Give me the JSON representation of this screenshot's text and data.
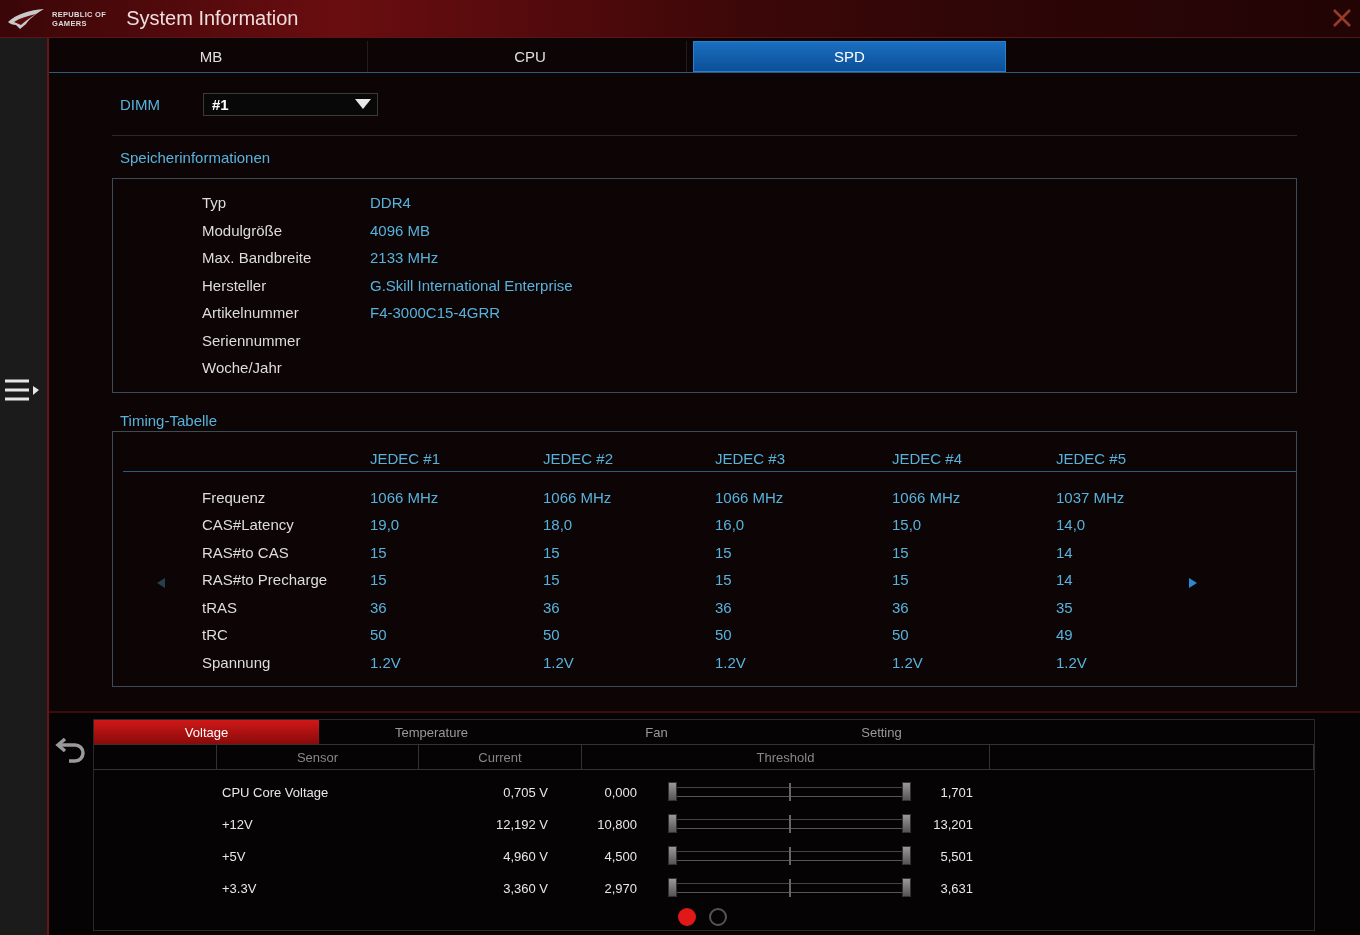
{
  "title_bar": {
    "logo_text": [
      "REPUBLIC OF",
      "GAMERS"
    ],
    "title": "System Information"
  },
  "tabs": [
    {
      "label": "MB",
      "selected": false
    },
    {
      "label": "CPU",
      "selected": false
    },
    {
      "label": "SPD",
      "selected": true
    }
  ],
  "dimm": {
    "label": "DIMM",
    "value": "#1"
  },
  "memory_info": {
    "title": "Speicherinformationen",
    "rows": [
      {
        "label": "Typ",
        "value": "DDR4"
      },
      {
        "label": "Modulgröße",
        "value": "4096 MB"
      },
      {
        "label": "Max. Bandbreite",
        "value": "2133 MHz"
      },
      {
        "label": "Hersteller",
        "value": "G.Skill International Enterprise"
      },
      {
        "label": "Artikelnummer",
        "value": "F4-3000C15-4GRR"
      },
      {
        "label": "Seriennummer"
      },
      {
        "label": "Woche/Jahr"
      }
    ]
  },
  "timing_table": {
    "title": "Timing-Tabelle",
    "columns": [
      "JEDEC #1",
      "JEDEC #2",
      "JEDEC #3",
      "JEDEC #4",
      "JEDEC #5"
    ],
    "rows": [
      {
        "label": "Frequenz",
        "values": [
          "1066 MHz",
          "1066 MHz",
          "1066 MHz",
          "1066 MHz",
          "1037 MHz"
        ]
      },
      {
        "label": "CAS#Latency",
        "values": [
          "19,0",
          "18,0",
          "16,0",
          "15,0",
          "14,0"
        ]
      },
      {
        "label": "RAS#to CAS",
        "values": [
          "15",
          "15",
          "15",
          "15",
          "14"
        ]
      },
      {
        "label": "RAS#to Precharge",
        "values": [
          "15",
          "15",
          "15",
          "15",
          "14"
        ]
      },
      {
        "label": "tRAS",
        "values": [
          "36",
          "36",
          "36",
          "36",
          "35"
        ]
      },
      {
        "label": "tRC",
        "values": [
          "50",
          "50",
          "50",
          "50",
          "49"
        ]
      },
      {
        "label": "Spannung",
        "values": [
          "1.2V",
          "1.2V",
          "1.2V",
          "1.2V",
          "1.2V"
        ]
      }
    ]
  },
  "monitor": {
    "tabs": [
      {
        "label": "Voltage",
        "selected": true
      },
      {
        "label": "Temperature",
        "selected": false
      },
      {
        "label": "Fan",
        "selected": false
      },
      {
        "label": "Setting",
        "selected": false
      }
    ],
    "columns": [
      "Sensor",
      "Current",
      "Threshold"
    ],
    "rows": [
      {
        "sensor": "CPU Core Voltage",
        "current": "0,705 V",
        "min": "0,000",
        "max": "1,701",
        "level": 1
      },
      {
        "sensor": "+12V",
        "current": "12,192 V",
        "min": "10,800",
        "max": "13,201",
        "level": 1
      },
      {
        "sensor": "+5V",
        "current": "4,960 V",
        "min": "4,500",
        "max": "5,501",
        "level": 1
      },
      {
        "sensor": "+3.3V",
        "current": "3,360 V",
        "min": "2,970",
        "max": "3,631",
        "level": 1
      }
    ],
    "pages": [
      {
        "selected": true
      },
      {
        "selected": false
      }
    ]
  }
}
